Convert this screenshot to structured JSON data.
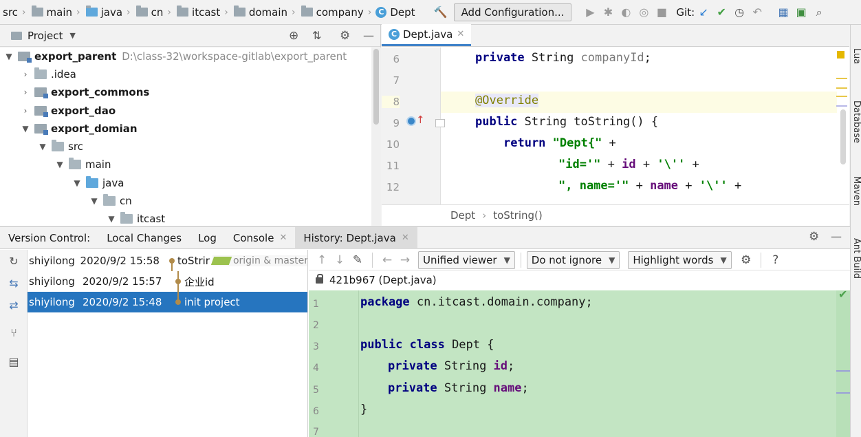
{
  "navbar": {
    "breadcrumbs": [
      "src",
      "main",
      "java",
      "cn",
      "itcast",
      "domain",
      "company"
    ],
    "current_class": "Dept",
    "add_config_label": "Add Configuration...",
    "git_label": "Git:"
  },
  "project": {
    "title": "Project",
    "tree": [
      {
        "label": "export_parent",
        "path": "D:\\class-32\\workspace-gitlab\\export_parent"
      },
      {
        "label": ".idea"
      },
      {
        "label": "export_commons"
      },
      {
        "label": "export_dao"
      },
      {
        "label": "export_domian"
      },
      {
        "label": "src"
      },
      {
        "label": "main"
      },
      {
        "label": "java"
      },
      {
        "label": "cn"
      },
      {
        "label": "itcast"
      }
    ]
  },
  "editor": {
    "tab_label": "Dept.java",
    "lines": [
      "6",
      "7",
      "8",
      "9",
      "10",
      "11",
      "12"
    ],
    "code": {
      "l6_kw": "private",
      "l6_type": " String ",
      "l6_name": "companyId",
      "l6_end": ";",
      "l8": "@Override",
      "l9_kw": "public",
      "l9_rest": " String toString() {",
      "l10_kw": "return",
      "l10_str": " \"Dept{\"",
      "l10_end": " +",
      "l11_str": "\"id='\"",
      "l11_mid": " + ",
      "l11_fld": "id",
      "l11_mid2": " + ",
      "l11_str2": "'\\''",
      "l11_end": " +",
      "l12_str": "\", name='\"",
      "l12_mid": " + ",
      "l12_fld": "name",
      "l12_mid2": " + ",
      "l12_str2": "'\\''",
      "l12_end": " +"
    },
    "breadcrumb": [
      "Dept",
      "toString()"
    ]
  },
  "right_strip": [
    "Lua",
    "Database",
    "Maven",
    "Ant Build"
  ],
  "bottom": {
    "tabs": [
      "Version Control:",
      "Local Changes",
      "Log",
      "Console",
      "History: Dept.java"
    ],
    "commits": [
      {
        "author": "shiyilong",
        "date": "2020/9/2 15:58",
        "message": "toStrir",
        "branch": "origin & master"
      },
      {
        "author": "shiyilong",
        "date": "2020/9/2 15:57",
        "message": "企业id"
      },
      {
        "author": "shiyilong",
        "date": "2020/9/2 15:48",
        "message": "init project"
      }
    ],
    "diff": {
      "viewer": "Unified viewer",
      "ignore": "Do not ignore",
      "highlight": "Highlight words",
      "file": "421b967 (Dept.java)",
      "lines": [
        "1",
        "2",
        "3",
        "4",
        "5",
        "6",
        "7"
      ],
      "code": {
        "l1_kw": "package",
        "l1_rest": " cn.itcast.domain.company;",
        "l3_kw": "public class",
        "l3_rest": " Dept {",
        "l4_kw": "private",
        "l4_type": " String ",
        "l4_fld": "id",
        "l4_end": ";",
        "l5_kw": "private",
        "l5_type": " String ",
        "l5_fld": "name",
        "l5_end": ";",
        "l6": "}"
      }
    }
  }
}
